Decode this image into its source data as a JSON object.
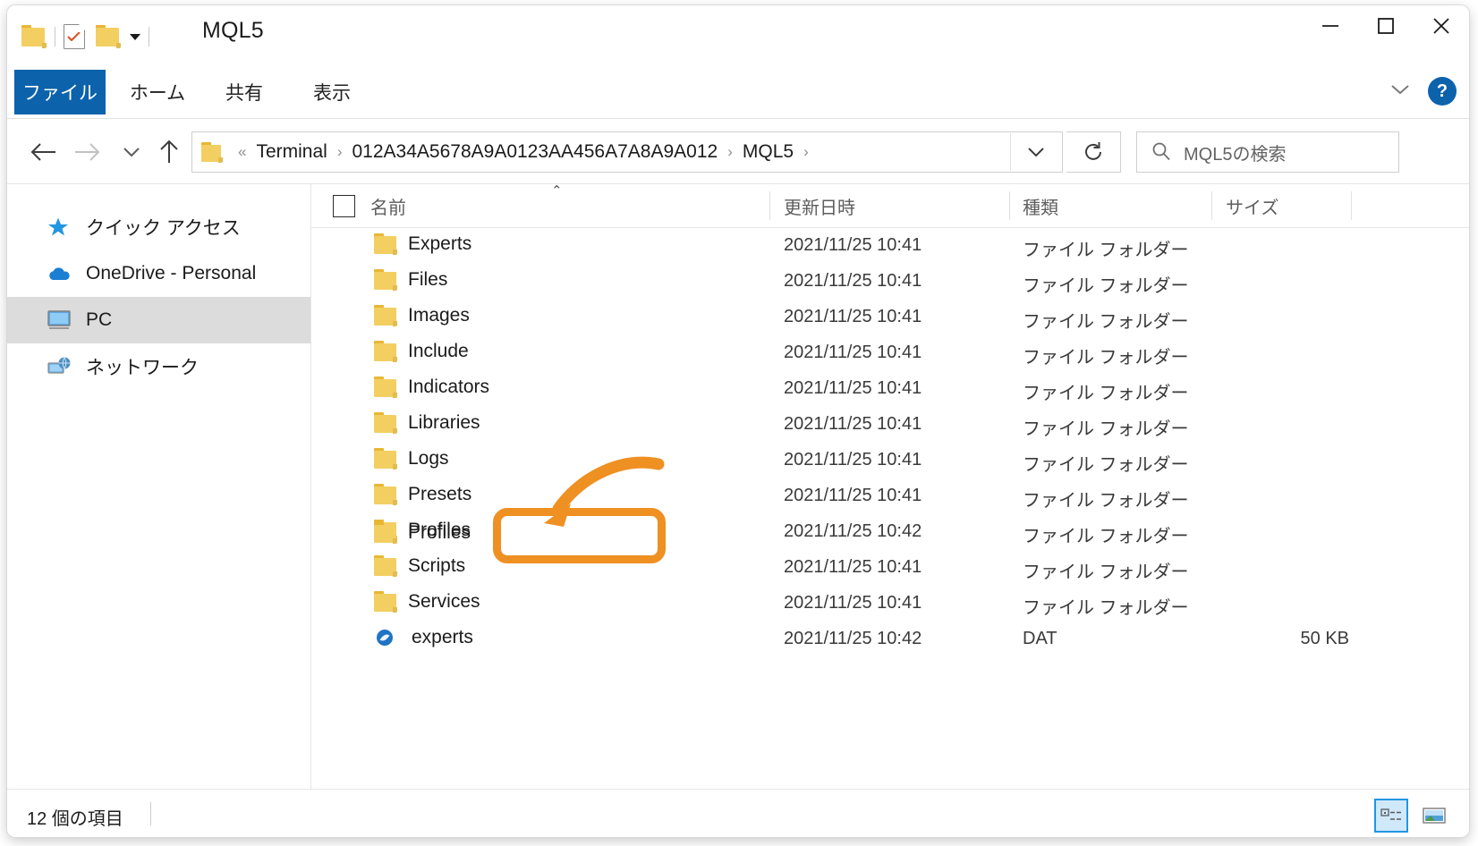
{
  "window": {
    "title": "MQL5",
    "controls": {
      "minimize": "minimize-button",
      "maximize": "maximize-button",
      "close": "close-button"
    }
  },
  "ribbon": {
    "tabs": [
      {
        "label": "ファイル",
        "active": true
      },
      {
        "label": "ホーム",
        "active": false
      },
      {
        "label": "共有",
        "active": false
      },
      {
        "label": "表示",
        "active": false
      }
    ],
    "help_label": "?"
  },
  "address": {
    "crumbs": [
      {
        "label": "«"
      },
      {
        "label": "Terminal"
      },
      {
        "label": "012A34A5678A9A0123AA456A7A8A9A012"
      },
      {
        "label": "MQL5"
      }
    ],
    "separator": "›"
  },
  "search": {
    "placeholder": "MQL5の検索"
  },
  "sidebar": {
    "items": [
      {
        "label": "クイック アクセス",
        "icon": "star-icon",
        "selected": false
      },
      {
        "label": "OneDrive - Personal",
        "icon": "cloud-icon",
        "selected": false
      },
      {
        "label": "PC",
        "icon": "monitor-icon",
        "selected": true
      },
      {
        "label": "ネットワーク",
        "icon": "network-icon",
        "selected": false
      }
    ]
  },
  "list": {
    "columns": [
      {
        "label": "名前"
      },
      {
        "label": "更新日時"
      },
      {
        "label": "種類"
      },
      {
        "label": "サイズ"
      }
    ],
    "sort_indicator": "⌃",
    "rows": [
      {
        "name": "Experts",
        "date": "2021/11/25 10:41",
        "type": "ファイル フォルダー",
        "size": "",
        "icon": "folder-icon"
      },
      {
        "name": "Files",
        "date": "2021/11/25 10:41",
        "type": "ファイル フォルダー",
        "size": "",
        "icon": "folder-icon"
      },
      {
        "name": "Images",
        "date": "2021/11/25 10:41",
        "type": "ファイル フォルダー",
        "size": "",
        "icon": "folder-icon"
      },
      {
        "name": "Include",
        "date": "2021/11/25 10:41",
        "type": "ファイル フォルダー",
        "size": "",
        "icon": "folder-icon"
      },
      {
        "name": "Indicators",
        "date": "2021/11/25 10:41",
        "type": "ファイル フォルダー",
        "size": "",
        "icon": "folder-icon"
      },
      {
        "name": "Libraries",
        "date": "2021/11/25 10:41",
        "type": "ファイル フォルダー",
        "size": "",
        "icon": "folder-icon"
      },
      {
        "name": "Logs",
        "date": "2021/11/25 10:41",
        "type": "ファイル フォルダー",
        "size": "",
        "icon": "folder-icon"
      },
      {
        "name": "Presets",
        "date": "2021/11/25 10:41",
        "type": "ファイル フォルダー",
        "size": "",
        "icon": "folder-icon"
      },
      {
        "name": "Profiles",
        "date": "2021/11/25 10:42",
        "type": "ファイル フォルダー",
        "size": "",
        "icon": "folder-icon"
      },
      {
        "name": "Scripts",
        "date": "2021/11/25 10:41",
        "type": "ファイル フォルダー",
        "size": "",
        "icon": "folder-icon"
      },
      {
        "name": "Services",
        "date": "2021/11/25 10:41",
        "type": "ファイル フォルダー",
        "size": "",
        "icon": "folder-icon"
      },
      {
        "name": "experts",
        "date": "2021/11/25 10:42",
        "type": "DAT",
        "size": "50 KB",
        "icon": "dat-file-icon"
      }
    ]
  },
  "annotation": {
    "target_row": "Profiles",
    "color": "#ef9022",
    "shape": "rounded-rectangle-with-arrow"
  },
  "status": {
    "item_count": "12 個の項目",
    "views": [
      {
        "name": "details-view",
        "selected": true
      },
      {
        "name": "large-icons-view",
        "selected": false
      }
    ]
  }
}
